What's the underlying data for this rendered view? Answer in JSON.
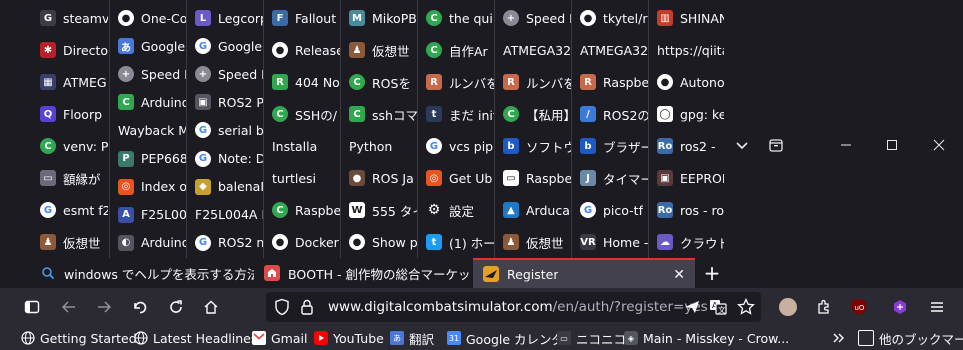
{
  "grid": {
    "columns": [
      {
        "items": [
          {
            "icon": "steam-icon",
            "label": "steamv",
            "bg": "#3c3c46",
            "glyph": "G"
          },
          {
            "icon": "gear-red-icon",
            "label": "Directo",
            "bg": "#b8202a",
            "glyph": "✱"
          },
          {
            "icon": "atmega-icon",
            "label": "ATMEG",
            "bg": "#3a3f6a",
            "glyph": "▦"
          },
          {
            "icon": "floorp-icon",
            "label": "Floorp",
            "bg": "#5a3fd8",
            "glyph": "Q"
          },
          {
            "icon": "green-c-icon",
            "label": "venv: P",
            "bg": "#2fa84f",
            "glyph": "C"
          },
          {
            "icon": "keyboard-icon",
            "label": "額縁が",
            "bg": "#6a6a7a",
            "glyph": "▭"
          },
          {
            "icon": "google-icon",
            "label": "esmt f2",
            "bg": "#ffffff",
            "glyph": "G"
          },
          {
            "icon": "avatar-icon",
            "label": "仮想世",
            "bg": "#8a5a3a",
            "glyph": "♟"
          }
        ]
      },
      {
        "items": [
          {
            "icon": "github-icon",
            "label": "One-Co",
            "bg": "#ffffff",
            "glyph": "●"
          },
          {
            "icon": "translate-icon",
            "label": "Google",
            "bg": "#4a78d8",
            "glyph": "あ"
          },
          {
            "icon": "plus-icon",
            "label": "Speed D",
            "bg": "#8a8a95",
            "glyph": "+"
          },
          {
            "icon": "arduino-icon",
            "label": "Arduino",
            "bg": "#2fa84f",
            "glyph": "C"
          },
          {
            "icon": "wayback-icon",
            "label": "Wayback M",
            "bg": "",
            "glyph": ""
          },
          {
            "icon": "pep-icon",
            "label": "PEP668",
            "bg": "#3a7a6a",
            "glyph": "P"
          },
          {
            "icon": "ubuntu-icon",
            "label": "Index o",
            "bg": "#e95420",
            "glyph": "◎"
          },
          {
            "icon": "pdf-icon",
            "label": "F25L00",
            "bg": "#3a4fa8",
            "glyph": "A"
          },
          {
            "icon": "arduino2-icon",
            "label": "Arduino",
            "bg": "#555560",
            "glyph": "◐"
          }
        ]
      },
      {
        "items": [
          {
            "icon": "legcorp-icon",
            "label": "Legcorp",
            "bg": "#6a5ac8",
            "glyph": "L"
          },
          {
            "icon": "google-icon",
            "label": "Google",
            "bg": "#ffffff",
            "glyph": "G"
          },
          {
            "icon": "plus-icon",
            "label": "Speed D",
            "bg": "#8a8a95",
            "glyph": "+"
          },
          {
            "icon": "ros-icon",
            "label": "ROS2 P",
            "bg": "#555560",
            "glyph": "▣"
          },
          {
            "icon": "google-icon",
            "label": "serial b",
            "bg": "#ffffff",
            "glyph": "G"
          },
          {
            "icon": "google-icon",
            "label": "Note: D",
            "bg": "#ffffff",
            "glyph": "G"
          },
          {
            "icon": "balena-icon",
            "label": "balenaE",
            "bg": "#c8a030",
            "glyph": "◆"
          },
          {
            "icon": "f25-icon",
            "label": "F25L004A P",
            "bg": "",
            "glyph": ""
          },
          {
            "icon": "google-icon",
            "label": "ROS2 n",
            "bg": "#ffffff",
            "glyph": "G"
          }
        ]
      },
      {
        "items": [
          {
            "icon": "fallout-icon",
            "label": "Fallout",
            "bg": "#3a6aa8",
            "glyph": "F"
          },
          {
            "icon": "github-icon",
            "label": "Release",
            "bg": "#ffffff",
            "glyph": "●"
          },
          {
            "icon": "404-icon",
            "label": "404 No",
            "bg": "#2fa84f",
            "glyph": "R"
          },
          {
            "icon": "green-c-icon",
            "label": "SSHの/",
            "bg": "#2fa84f",
            "glyph": "C"
          },
          {
            "icon": "install-icon",
            "label": "Installa",
            "bg": "",
            "glyph": ""
          },
          {
            "icon": "turtle-icon",
            "label": "turtlesi",
            "bg": "",
            "glyph": ""
          },
          {
            "icon": "green-c-icon",
            "label": "Raspbe",
            "bg": "#2fa84f",
            "glyph": "C"
          },
          {
            "icon": "github-icon",
            "label": "Docker",
            "bg": "#ffffff",
            "glyph": "●"
          }
        ]
      },
      {
        "items": [
          {
            "icon": "mikopb-icon",
            "label": "MikoPB",
            "bg": "#4a8a9a",
            "glyph": "M"
          },
          {
            "icon": "avatar-icon",
            "label": "仮想世",
            "bg": "#8a5a3a",
            "glyph": "♟"
          },
          {
            "icon": "green-c-icon",
            "label": "ROSを",
            "bg": "#2fa84f",
            "glyph": "C"
          },
          {
            "icon": "ssh-icon",
            "label": "sshコマ",
            "bg": "#2fa84f",
            "glyph": "C"
          },
          {
            "icon": "python-icon",
            "label": "Python",
            "bg": "",
            "glyph": ""
          },
          {
            "icon": "rosja-icon",
            "label": "ROS Ja",
            "bg": "#6a4a3a",
            "glyph": "●"
          },
          {
            "icon": "w-icon",
            "label": "555 タイ",
            "bg": "#ffffff",
            "glyph": "W"
          },
          {
            "icon": "github-icon",
            "label": "Show p",
            "bg": "#ffffff",
            "glyph": "●"
          }
        ]
      },
      {
        "items": [
          {
            "icon": "green-c-icon",
            "label": "the qui",
            "bg": "#2fa84f",
            "glyph": "C"
          },
          {
            "icon": "green-c-icon",
            "label": "自作Ar",
            "bg": "#2fa84f",
            "glyph": "C"
          },
          {
            "icon": "roomba-icon",
            "label": "ルンバを",
            "bg": "#c86a4a",
            "glyph": "R"
          },
          {
            "icon": "tumblr-icon",
            "label": "まだ init",
            "bg": "#2a3a5a",
            "glyph": "t"
          },
          {
            "icon": "google-icon",
            "label": "vcs pip",
            "bg": "#ffffff",
            "glyph": "G"
          },
          {
            "icon": "ubuntu-icon",
            "label": "Get Ub",
            "bg": "#e95420",
            "glyph": "◎"
          },
          {
            "icon": "settings-icon",
            "label": "設定",
            "bg": "",
            "glyph": "⚙"
          },
          {
            "icon": "twitter-icon",
            "label": "(1) ホー",
            "bg": "#1d9bf0",
            "glyph": "t"
          }
        ]
      },
      {
        "items": [
          {
            "icon": "plus-icon",
            "label": "Speed D",
            "bg": "#8a8a95",
            "glyph": "+"
          },
          {
            "icon": "atmega-icon",
            "label": "ATMEGA32",
            "bg": "",
            "glyph": ""
          },
          {
            "icon": "roomba-icon",
            "label": "ルンバを",
            "bg": "#c86a4a",
            "glyph": "R"
          },
          {
            "icon": "green-c-icon",
            "label": "【私用】",
            "bg": "#2fa84f",
            "glyph": "C"
          },
          {
            "icon": "bethor-icon",
            "label": "ソフトウ",
            "bg": "#1d5ac8",
            "glyph": "b"
          },
          {
            "icon": "ioio-icon",
            "label": "Raspbe",
            "bg": "#ffffff",
            "glyph": "▭"
          },
          {
            "icon": "arduca-icon",
            "label": "Arduca",
            "bg": "#1d7ac8",
            "glyph": "▲"
          },
          {
            "icon": "avatar-icon",
            "label": "仮想世",
            "bg": "#8a5a3a",
            "glyph": "♟"
          }
        ]
      },
      {
        "items": [
          {
            "icon": "github-icon",
            "label": "tkytel/r",
            "bg": "#ffffff",
            "glyph": "●"
          },
          {
            "icon": "atmega-icon",
            "label": "ATMEGA32",
            "bg": "",
            "glyph": ""
          },
          {
            "icon": "raspberry-icon",
            "label": "Raspbe",
            "bg": "#c86a4a",
            "glyph": "R"
          },
          {
            "icon": "ros2-icon",
            "label": "ROS2の",
            "bg": "#3a7ad8",
            "glyph": "/"
          },
          {
            "icon": "bethor-icon",
            "label": "ブラザー",
            "bg": "#1d5ac8",
            "glyph": "b"
          },
          {
            "icon": "timer-icon",
            "label": "タイマー",
            "bg": "#6a8aa8",
            "glyph": "J"
          },
          {
            "icon": "google-icon",
            "label": "pico-tf",
            "bg": "#ffffff",
            "glyph": "G"
          },
          {
            "icon": "vr-icon",
            "label": "Home -",
            "bg": "#3a3a44",
            "glyph": "VR"
          }
        ]
      },
      {
        "items": [
          {
            "icon": "shinano-icon",
            "label": "SHINAN",
            "bg": "#c83a2a",
            "glyph": "▥"
          },
          {
            "icon": "qiita-icon",
            "label": "https://qiita.",
            "bg": "",
            "glyph": ""
          },
          {
            "icon": "github-icon",
            "label": "Autono",
            "bg": "#ffffff",
            "glyph": "●"
          },
          {
            "icon": "gpg-icon",
            "label": "gpg: ke",
            "bg": "#ffffff",
            "glyph": "◯"
          },
          {
            "icon": "ro-icon",
            "label": "ros2 -",
            "bg": "#3a6aa8",
            "glyph": "Ro"
          },
          {
            "icon": "eeprom-icon",
            "label": "EEPROI",
            "bg": "#5a3a3a",
            "glyph": "▣"
          },
          {
            "icon": "ro-icon",
            "label": "ros - ro",
            "bg": "#3a6aa8",
            "glyph": "Ro"
          },
          {
            "icon": "cloud-icon",
            "label": "クラウド",
            "bg": "#6a5ac8",
            "glyph": "☁"
          }
        ]
      }
    ]
  },
  "tabs": [
    {
      "title": "windows でヘルプを表示する方法 - Ч",
      "icon": "search-icon",
      "active": false
    },
    {
      "title": "BOOTH - 創作物の総合マーケット",
      "icon": "booth-icon",
      "active": false
    },
    {
      "title": "Register",
      "icon": "dcs-icon",
      "active": true
    }
  ],
  "tab_close": "✕",
  "new_tab": "+",
  "url": {
    "domain": "www.digitalcombatsimulator.com",
    "rest": "/en/auth/?register=yes"
  },
  "bookmarks": [
    {
      "label": "Getting Started",
      "icon": "globe-icon"
    },
    {
      "label": "Latest Headlines",
      "icon": "globe-icon"
    },
    {
      "label": "Gmail",
      "icon": "gmail-icon"
    },
    {
      "label": "YouTube",
      "icon": "youtube-icon"
    },
    {
      "label": "翻訳",
      "icon": "translate-icon"
    },
    {
      "label": "Google カレンダ",
      "icon": "calendar-icon"
    },
    {
      "label": "ニコニコ",
      "icon": "niconico-icon"
    },
    {
      "label": "Main - Misskey - Crow...",
      "icon": "misskey-icon"
    }
  ],
  "other_bookmarks": "他のブックマーク",
  "colors": {
    "accent": "#e0322f",
    "bg": "#1c1b22",
    "toolbar": "#2b2a33"
  }
}
